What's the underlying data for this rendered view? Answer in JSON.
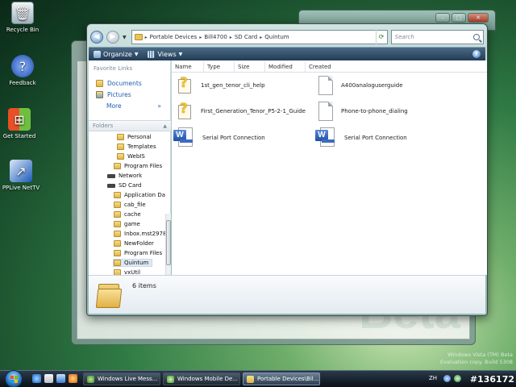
{
  "desktop": {
    "icons": [
      {
        "label": "Recycle Bin"
      },
      {
        "label": "Feedback"
      },
      {
        "label": "Get Started"
      },
      {
        "label": "PPLive NetTV"
      }
    ],
    "watermark_line1": "Windows Vista (TM) Beta",
    "watermark_line2": "Evaluation copy. Build 5308",
    "background_watermark": "Beta",
    "image_tag": "#136172"
  },
  "explorer": {
    "breadcrumb": [
      "Portable Devices",
      "Bill4700",
      "SD Card",
      "Quintum"
    ],
    "search_placeholder": "Search",
    "toolbar": {
      "organize": "Organize",
      "views": "Views"
    },
    "favorite_links": {
      "header": "Favorite Links",
      "items": [
        {
          "label": "Documents"
        },
        {
          "label": "Pictures"
        }
      ],
      "more": "More",
      "more_chevron": "»"
    },
    "folders_header": "Folders",
    "tree": [
      {
        "label": "Personal"
      },
      {
        "label": "Templates"
      },
      {
        "label": "WebIS"
      },
      {
        "label": "Program Files"
      },
      {
        "label": "Network"
      },
      {
        "label": "SD Card"
      },
      {
        "label": "Application Da"
      },
      {
        "label": "cab_file"
      },
      {
        "label": "cache"
      },
      {
        "label": "game"
      },
      {
        "label": "Inbox.mst2978"
      },
      {
        "label": "NewFolder"
      },
      {
        "label": "Program Files"
      },
      {
        "label": "Quintum"
      },
      {
        "label": "vxUtil"
      }
    ],
    "columns": [
      "Name",
      "Type",
      "Size",
      "Modified",
      "Created"
    ],
    "files": [
      {
        "name": "1st_gen_tenor_cli_help",
        "icon": "help-file-icon"
      },
      {
        "name": "A400analoguserguide",
        "icon": "document-icon"
      },
      {
        "name": "First_Generation_Tenor_P5-2-1_Guide",
        "icon": "help-file-icon"
      },
      {
        "name": "Phone-to-phone_dialing",
        "icon": "document-icon"
      },
      {
        "name": "Serial Port Connection",
        "icon": "word-document-icon"
      },
      {
        "name": "Serial Port Connection",
        "icon": "word-document-icon"
      }
    ],
    "details": {
      "count_text": "6 items"
    }
  },
  "taskbar": {
    "buttons": [
      {
        "label": "Windows Live Mess..."
      },
      {
        "label": "Windows Mobile De..."
      },
      {
        "label": "Portable Devices\\Bil..."
      }
    ],
    "language": "ZH"
  },
  "colors": {
    "accent": "#1f5fb3",
    "toolbar": "#213c55",
    "folder": "#e1b145"
  }
}
